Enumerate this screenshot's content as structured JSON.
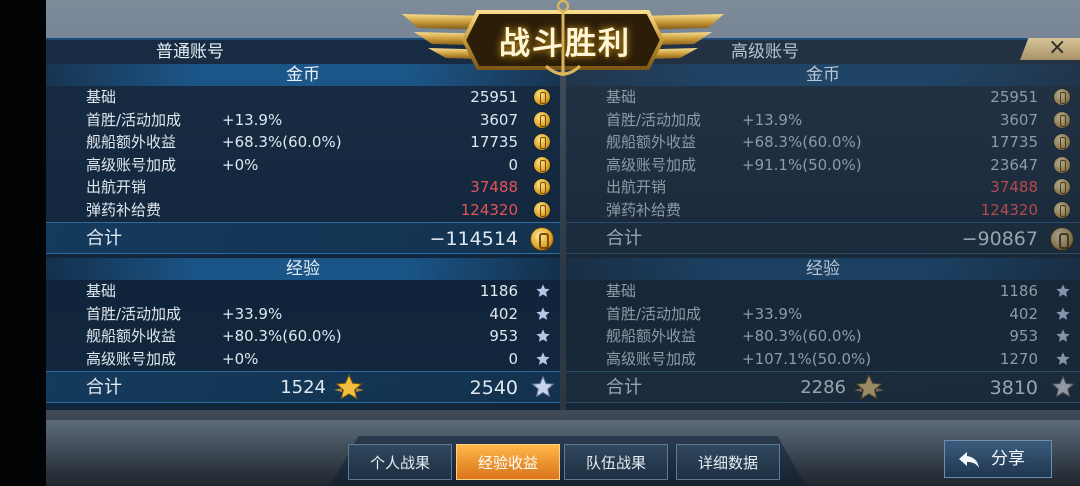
{
  "title": "战斗胜利",
  "close_symbol": "×",
  "left_panel": {
    "account_title": "普通账号",
    "gold": {
      "header": "金币",
      "rows": [
        {
          "label": "基础",
          "pct": "",
          "value": "25951",
          "red": false
        },
        {
          "label": "首胜/活动加成",
          "pct": "+13.9%",
          "value": "3607",
          "red": false
        },
        {
          "label": "舰船额外收益",
          "pct": "+68.3%(60.0%)",
          "value": "17735",
          "red": false
        },
        {
          "label": "高级账号加成",
          "pct": "+0%",
          "value": "0",
          "red": false
        },
        {
          "label": "出航开销",
          "pct": "",
          "value": "37488",
          "red": true
        },
        {
          "label": "弹药补给费",
          "pct": "",
          "value": "124320",
          "red": true
        }
      ],
      "total_label": "合计",
      "total_value": "−114514"
    },
    "exp": {
      "header": "经验",
      "rows": [
        {
          "label": "基础",
          "pct": "",
          "value": "1186"
        },
        {
          "label": "首胜/活动加成",
          "pct": "+33.9%",
          "value": "402"
        },
        {
          "label": "舰船额外收益",
          "pct": "+80.3%(60.0%)",
          "value": "953"
        },
        {
          "label": "高级账号加成",
          "pct": "+0%",
          "value": "0"
        }
      ],
      "total_label": "合计",
      "total_mid": "1524",
      "total_value": "2540"
    }
  },
  "right_panel": {
    "account_title": "高级账号",
    "gold": {
      "header": "金币",
      "rows": [
        {
          "label": "基础",
          "pct": "",
          "value": "25951",
          "red": false
        },
        {
          "label": "首胜/活动加成",
          "pct": "+13.9%",
          "value": "3607",
          "red": false
        },
        {
          "label": "舰船额外收益",
          "pct": "+68.3%(60.0%)",
          "value": "17735",
          "red": false
        },
        {
          "label": "高级账号加成",
          "pct": "+91.1%(50.0%)",
          "value": "23647",
          "red": false
        },
        {
          "label": "出航开销",
          "pct": "",
          "value": "37488",
          "red": true
        },
        {
          "label": "弹药补给费",
          "pct": "",
          "value": "124320",
          "red": true
        }
      ],
      "total_label": "合计",
      "total_value": "−90867"
    },
    "exp": {
      "header": "经验",
      "rows": [
        {
          "label": "基础",
          "pct": "",
          "value": "1186"
        },
        {
          "label": "首胜/活动加成",
          "pct": "+33.9%",
          "value": "402"
        },
        {
          "label": "舰船额外收益",
          "pct": "+80.3%(60.0%)",
          "value": "953"
        },
        {
          "label": "高级账号加成",
          "pct": "+107.1%(50.0%)",
          "value": "1270"
        }
      ],
      "total_label": "合计",
      "total_mid": "2286",
      "total_value": "3810"
    }
  },
  "tabs": [
    {
      "label": "个人战果",
      "active": false
    },
    {
      "label": "经验收益",
      "active": true
    },
    {
      "label": "队伍战果",
      "active": false
    },
    {
      "label": "详细数据",
      "active": false
    }
  ],
  "share": {
    "label": "分享",
    "icon": "share-arrow-icon"
  },
  "colors": {
    "accent_gold": "#d9a224",
    "active_tab": "#f59a2e",
    "negative": "#e4545a",
    "panel_blue": "#0a2037"
  }
}
